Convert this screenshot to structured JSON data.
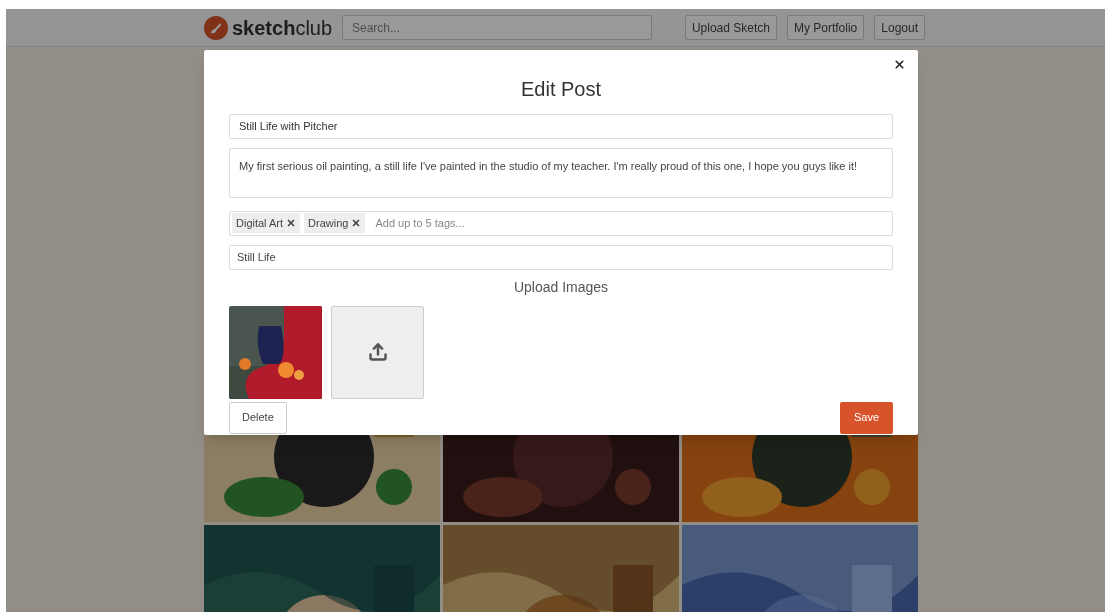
{
  "navbar": {
    "logo": "**sketch**club",
    "search": {
      "placeholder": "Search..."
    },
    "buttons": [
      "Upload Sketch",
      "My Portfolio",
      "Logout"
    ]
  },
  "modal": {
    "title": "Edit Post",
    "title_field": {
      "value": "Still Life with Pitcher"
    },
    "description_field": {
      "value": "My first serious oil painting, a still life I've painted in the studio of my teacher. I'm really proud of this one, I hope you guys like it!"
    },
    "tags": [
      "Digital Art",
      "Drawing"
    ],
    "tags_field": {
      "placeholder": "Add up to 5 tags..."
    },
    "category_field": {
      "value": "Still Life"
    },
    "upload_heading": "Upload Images",
    "images": [
      {
        "kind": "picture"
      },
      {
        "kind": "upload"
      }
    ],
    "delete_button": "Delete",
    "save_button": "Save"
  }
}
